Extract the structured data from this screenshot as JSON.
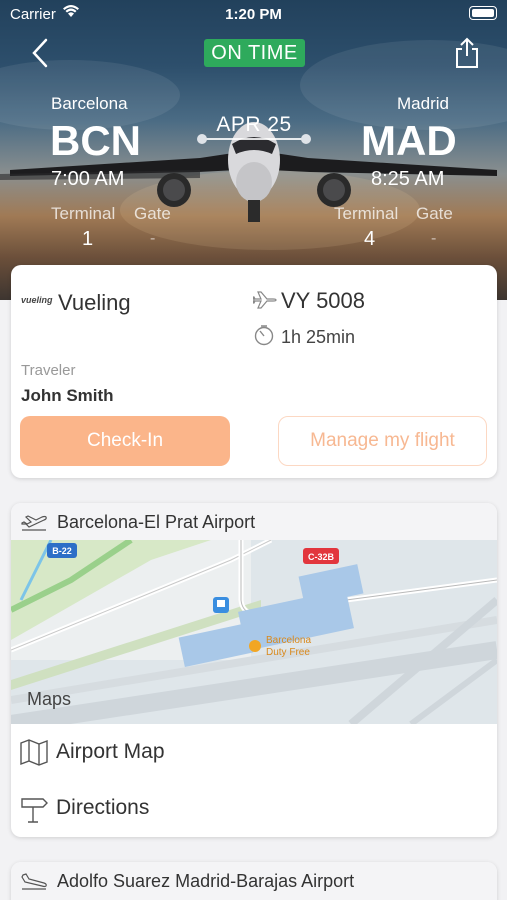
{
  "status_bar": {
    "carrier": "Carrier",
    "time": "1:20 PM"
  },
  "flight": {
    "status": "ON TIME",
    "date": "APR 25",
    "origin": {
      "city": "Barcelona",
      "code": "BCN",
      "time": "7:00 AM",
      "terminal": "1",
      "gate": "-"
    },
    "destination": {
      "city": "Madrid",
      "code": "MAD",
      "time": "8:25 AM",
      "terminal": "4",
      "gate": "-"
    },
    "terminal_label": "Terminal",
    "gate_label": "Gate"
  },
  "details": {
    "airline_logo_text": "vueling",
    "airline": "Vueling",
    "flight_number": "VY 5008",
    "duration": "1h 25min",
    "traveler_label": "Traveler",
    "traveler_name": "John Smith",
    "checkin_label": "Check-In",
    "manage_label": "Manage my flight"
  },
  "departure_airport": {
    "name": "Barcelona-El Prat Airport",
    "map_attribution": "Maps",
    "map_labels": {
      "road1": "B-22",
      "road2": "C-32B",
      "poi": "Barcelona\nDuty Free"
    },
    "airport_map_label": "Airport Map",
    "directions_label": "Directions"
  },
  "arrival_airport": {
    "name": "Adolfo Suarez Madrid-Barajas Airport"
  },
  "colors": {
    "status_green": "#2eaa5c",
    "checkin_orange": "#fbb58a",
    "manage_border": "#fcd8c3"
  }
}
